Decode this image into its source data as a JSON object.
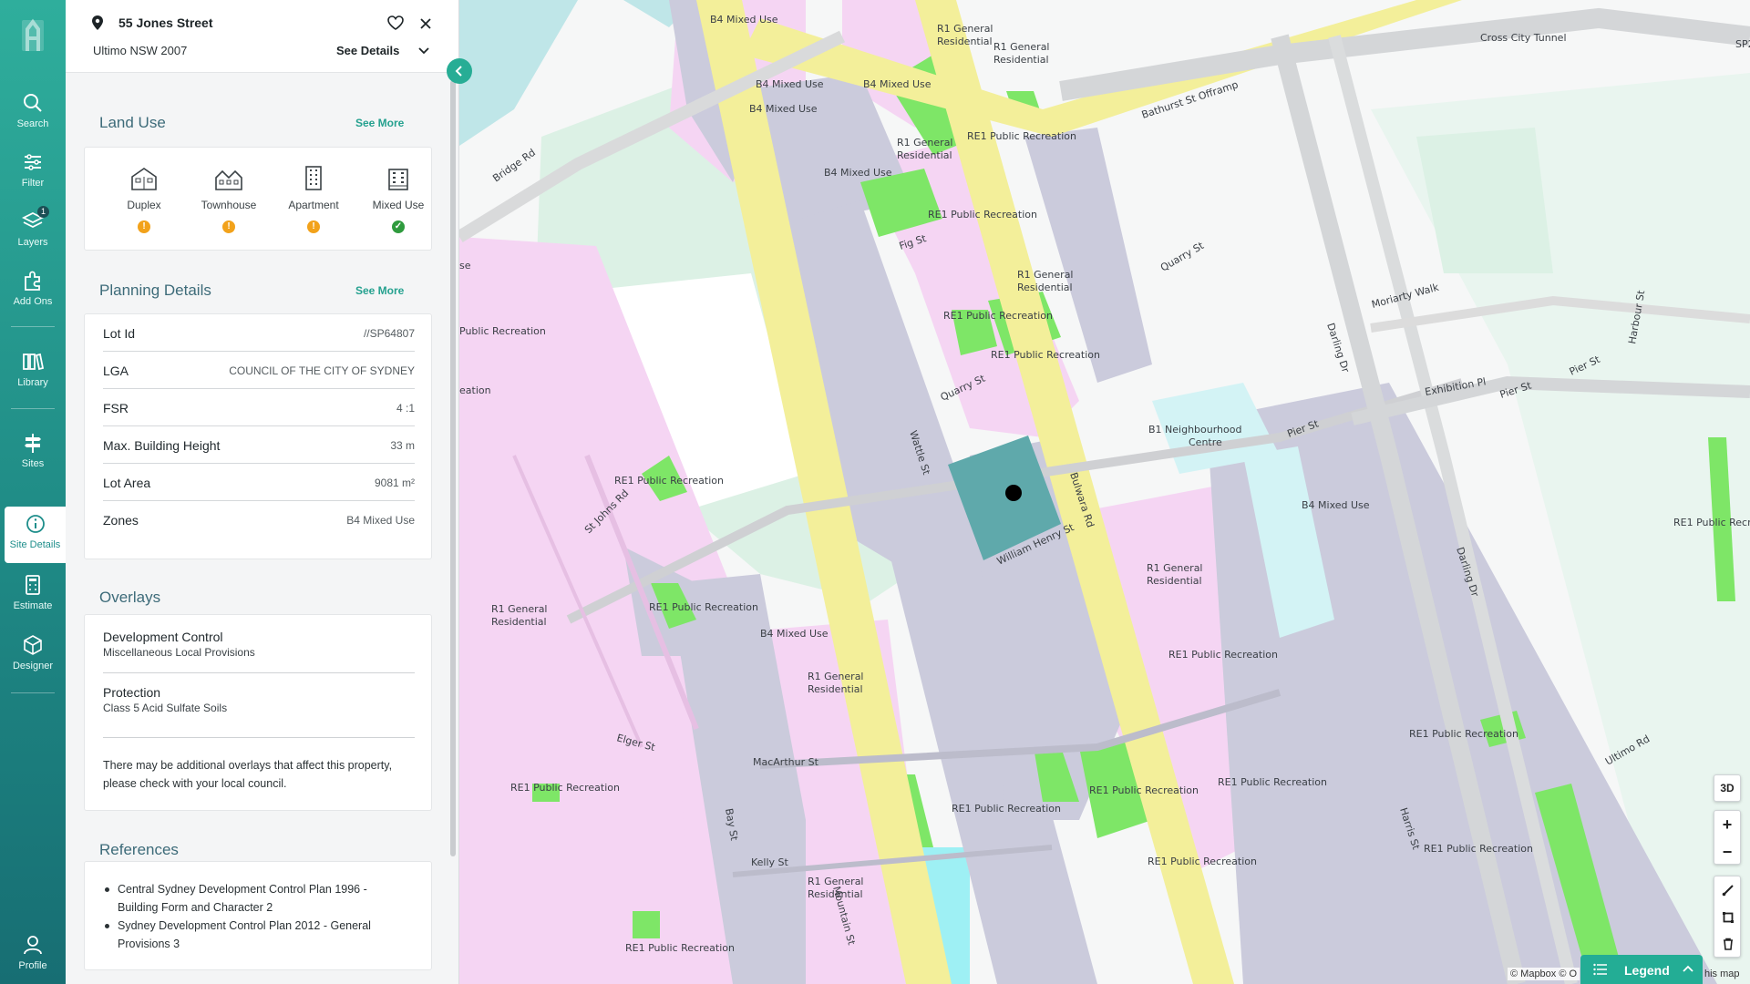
{
  "nav": {
    "items": [
      {
        "label": "Search",
        "icon": "search-icon"
      },
      {
        "label": "Filter",
        "icon": "filter-icon"
      },
      {
        "label": "Layers",
        "icon": "layers-icon",
        "badge": "1"
      },
      {
        "label": "Add Ons",
        "icon": "puzzle-icon"
      },
      {
        "label": "Library",
        "icon": "library-icon"
      },
      {
        "label": "Sites",
        "icon": "signpost-icon"
      },
      {
        "label": "Site Details",
        "icon": "info-icon"
      },
      {
        "label": "Estimate",
        "icon": "calculator-icon"
      },
      {
        "label": "Designer",
        "icon": "cube-icon"
      },
      {
        "label": "Profile",
        "icon": "user-icon"
      }
    ]
  },
  "address": {
    "street": "55 Jones Street",
    "suburb": "Ultimo NSW 2007",
    "see_details": "See Details"
  },
  "land_use": {
    "title": "Land Use",
    "see_more": "See More",
    "items": [
      {
        "label": "Duplex",
        "status": "!"
      },
      {
        "label": "Townhouse",
        "status": "!"
      },
      {
        "label": "Apartment",
        "status": "!"
      },
      {
        "label": "Mixed Use",
        "status": "✓"
      }
    ]
  },
  "planning": {
    "title": "Planning Details",
    "see_more": "See More",
    "rows": [
      {
        "key": "Lot Id",
        "value": "//SP64807"
      },
      {
        "key": "LGA",
        "value": "COUNCIL OF THE CITY OF SYDNEY"
      },
      {
        "key": "FSR",
        "value": "4 :1"
      },
      {
        "key": "Max. Building Height",
        "value": "33 m"
      },
      {
        "key": "Lot Area",
        "value": "9081 m²"
      },
      {
        "key": "Zones",
        "value": "B4 Mixed Use"
      }
    ]
  },
  "overlays": {
    "title": "Overlays",
    "items": [
      {
        "title": "Development Control",
        "sub": "Miscellaneous Local Provisions"
      },
      {
        "title": "Protection",
        "sub": "Class 5 Acid Sulfate Soils"
      }
    ],
    "note": "There may be additional overlays that affect this property, please check with your local council."
  },
  "references": {
    "title": "References",
    "items": [
      "Central Sydney Development Control Plan 1996 - Building Form and Character 2",
      "Sydney Development Control Plan 2012 - General Provisions 3"
    ]
  },
  "map": {
    "labels": {
      "zones": [
        "B4 Mixed Use",
        "R1 General Residential",
        "RE1 Public Recreation",
        "B1 Neighbourhood Centre"
      ],
      "streets": [
        "Wattle St",
        "Harris St",
        "Darling Dr",
        "Pier St",
        "Bathurst St Offramp",
        "Cross City Tunnel",
        "Fig St",
        "Quarry St",
        "William Henry St",
        "Bulwara Rd",
        "St Johns Rd",
        "Bridge Rd",
        "MacArthur St",
        "Elger St",
        "Kelly St",
        "Mountain St",
        "Bay St",
        "Jones St",
        "Moriarty Walk",
        "Exhibition Pl",
        "Ultimo Rd",
        "Harbour St",
        "Quarry St"
      ]
    },
    "controls": [
      "3D",
      "+",
      "−"
    ],
    "legend": "Legend",
    "attribution": "© Mapbox © O",
    "attribution_tail": "his map",
    "zone_colors": {
      "b4": "#cbcbdc",
      "r1": "#f5d5f3",
      "re1": "#7ee667",
      "b1": "#d3f3f5",
      "park": "#dcf1e5",
      "water": "#bfe6e8",
      "road": "#f3ef9a"
    }
  }
}
